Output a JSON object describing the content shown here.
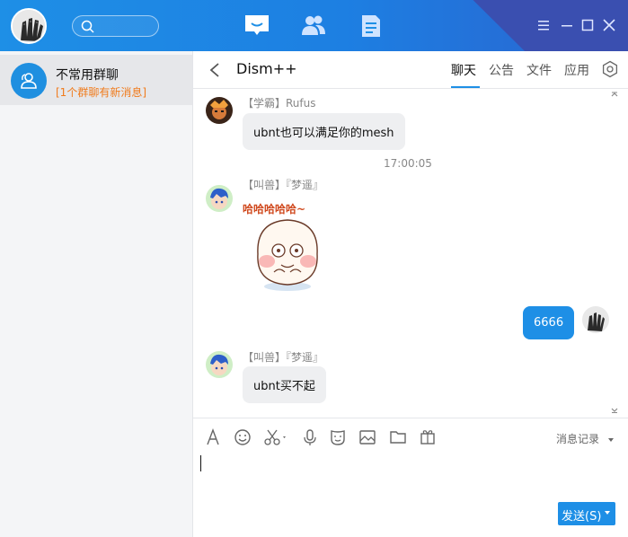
{
  "window": {
    "menu_icon": "menu-icon",
    "minimize_icon": "minimize-icon",
    "maximize_icon": "maximize-icon",
    "close_icon": "close-icon"
  },
  "topnav": {
    "items": [
      "chat-icon",
      "contacts-icon",
      "apps-icon"
    ],
    "active": "chat-icon"
  },
  "sidebar": {
    "conversations": [
      {
        "name": "不常用群聊",
        "subtitle": "[1个群聊有新消息]",
        "icon": "group-icon"
      }
    ]
  },
  "chat": {
    "title": "Dism++",
    "tabs": [
      {
        "label": "聊天",
        "active": true
      },
      {
        "label": "公告",
        "active": false
      },
      {
        "label": "文件",
        "active": false
      },
      {
        "label": "应用",
        "active": false
      }
    ]
  },
  "messages": [
    {
      "sender": "【学霸】Rufus",
      "text": "ubnt也可以满足你的mesh"
    },
    {
      "timestamp": "17:00:05"
    },
    {
      "sender": "【叫兽】『梦遥』",
      "sticker_text": "哈哈哈哈哈~"
    },
    {
      "mine": true,
      "text": "6666"
    },
    {
      "sender": "【叫兽】『梦遥』",
      "text": "ubnt买不起"
    }
  ],
  "toolbar": {
    "icons": [
      "font-icon",
      "emoji-icon",
      "screenshot-icon",
      "voice-icon",
      "sticker-icon",
      "image-icon",
      "folder-icon",
      "more-apps-icon"
    ],
    "history_label": "消息记录"
  },
  "input": {
    "send_label": "发送(S)"
  },
  "colors": {
    "accent": "#1e8fe6",
    "unread": "#f07b1c",
    "header_dark": "#3a4fb0"
  }
}
